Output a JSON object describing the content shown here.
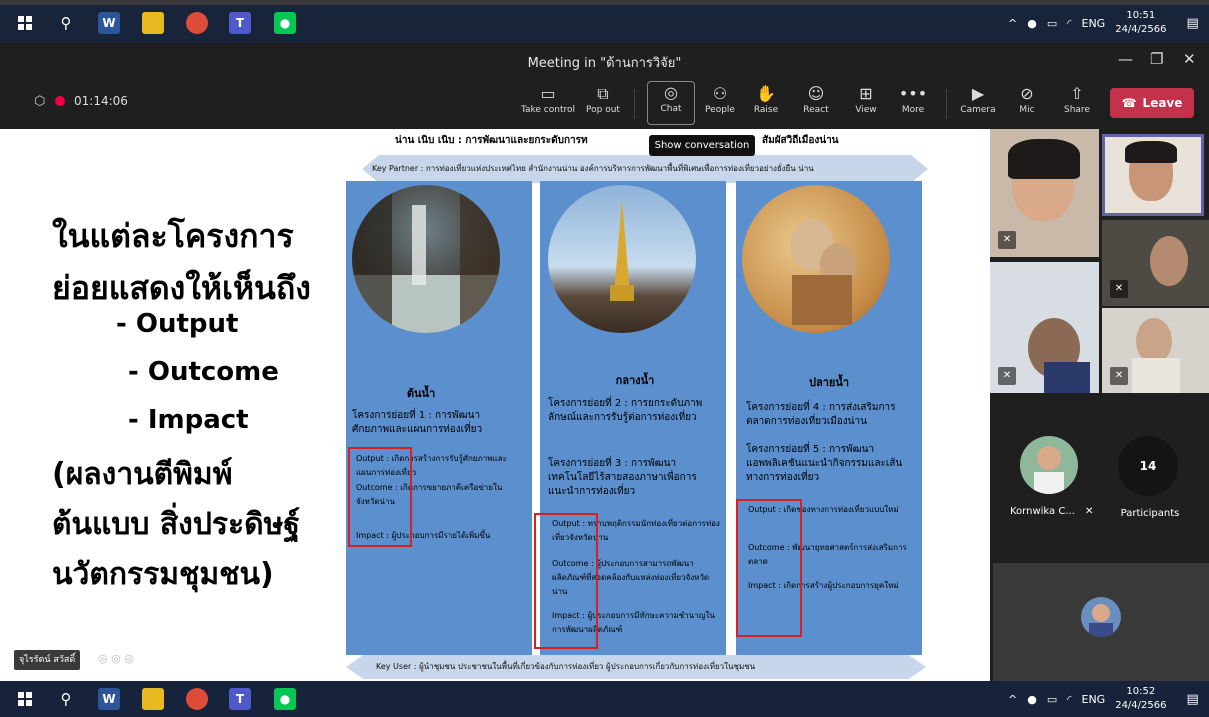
{
  "taskbar_top": {
    "time": "10:51",
    "date": "24/4/2566",
    "lang": "ENG"
  },
  "taskbar_bottom": {
    "time": "10:52",
    "date": "24/4/2566",
    "lang": "ENG"
  },
  "window": {
    "title": "Meeting in \"ด้านการวิจัย\""
  },
  "meeting": {
    "timer": "01:14:06"
  },
  "toolbar": {
    "take_control": "Take control",
    "pop_out": "Pop out",
    "chat": "Chat",
    "people": "People",
    "raise": "Raise",
    "react": "React",
    "view": "View",
    "more": "More",
    "camera": "Camera",
    "mic": "Mic",
    "share": "Share",
    "leave": "Leave"
  },
  "tooltip": "Show conversation",
  "slide": {
    "header_left": "น่าน เนิบ เนิบ : การพัฒนาและยกระดับการท",
    "header_right": "สัมผัสวิถีเมืองน่าน",
    "key_partner": "Key Partner : การท่องเที่ยวแห่งประเทศไทย สำนักงานน่าน องค์การบริหารการพัฒนาพื้นที่พิเศษเพื่อการท่องเที่ยวอย่างยั่งยืน น่าน",
    "big_lines": [
      "ในแต่ละโครงการ",
      "ย่อยแสดงให้เห็นถึง",
      "- Output",
      "- Outcome",
      "- Impact",
      "(ผลงานตีพิมพ์",
      "ต้นแบบ สิ่งประดิษฐ์",
      "นวัตกรรมชุมชน)"
    ],
    "col1": {
      "heading": "ต้นน้ำ",
      "project": "โครงการย่อยที่ 1 : การพัฒนาศักยภาพและแผนการท่องเที่ยว",
      "output": "Output : เกิดการสร้างการรับรู้ศักยภาพและแผนการท่องเที่ยว",
      "outcome": "Outcome : เกิดการขยายภาคีเครือข่ายในจังหวัดน่าน",
      "impact": "Impact : ผู้ประกอบการมีรายได้เพิ่มขึ้น"
    },
    "col2": {
      "heading": "กลางน้ำ",
      "project2": "โครงการย่อยที่ 2 : การยกระดับภาพลักษณ์และการรับรู้ต่อการท่องเที่ยว",
      "project3": "โครงการย่อยที่ 3 : การพัฒนาเทคโนโลยีไร้สายสองภาษาเพื่อการแนะนำการท่องเที่ยว",
      "output": "Output : ทราบพฤติกรรมนักท่องเที่ยวต่อการท่องเที่ยวจังหวัดน่าน",
      "outcome": "Outcome : ผู้ประกอบการสามารถพัฒนาผลิตภัณฑ์ที่สอดคล้องกับแหล่งท่องเที่ยวจังหวัดน่าน",
      "impact": "Impact : ผู้ประกอบการมีทักษะความชำนาญในการพัฒนาผลิตภัณฑ์"
    },
    "col3": {
      "heading": "ปลายน้ำ",
      "project4": "โครงการย่อยที่ 4 : การส่งเสริมการตลาดการท่องเที่ยวเมืองน่าน",
      "project5": "โครงการย่อยที่ 5 : การพัฒนาแอพพลิเคชันแนะนำกิจกรรมและเส้นทางการท่องเที่ยว",
      "output": "Output : เกิดช่องทางการท่องเที่ยวแบบใหม่",
      "outcome": "Outcome : พัฒนายุทธศาสตร์การส่งเสริมการตลาด",
      "impact": "Impact : เกิดการสร้างผู้ประกอบการยุคใหม่"
    },
    "key_user": "Key User : ผู้นำชุมชน ประชาชนในพื้นที่เกี่ยวข้องกับการท่องเที่ยว ผู้ประกอบการเกี่ยวกับการท่องเที่ยวในชุมชน",
    "presenter_name": "จุไรรัตน์ สวัสดิ์"
  },
  "participants": {
    "named": "Kornwika C...",
    "count": "14",
    "count_label": "Participants"
  }
}
